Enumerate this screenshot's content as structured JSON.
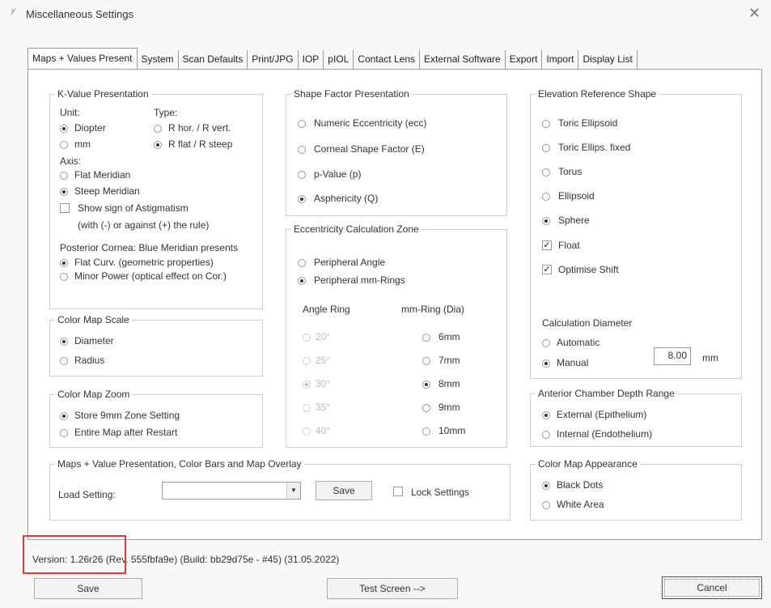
{
  "window": {
    "title": "Miscellaneous Settings",
    "icon_name": "app-icon",
    "close_icon": "close-icon"
  },
  "tabs": [
    "Maps + Values Present",
    "System",
    "Scan Defaults",
    "Print/JPG",
    "IOP",
    "pIOL",
    "Contact Lens",
    "External Software",
    "Export",
    "Import",
    "Display List"
  ],
  "kvalue": {
    "title": "K-Value Presentation",
    "unit_label": "Unit:",
    "type_label": "Type:",
    "unit_options": [
      "Diopter",
      "mm"
    ],
    "unit_selected": "Diopter",
    "type_options": [
      "R hor. / R vert.",
      "R flat / R steep"
    ],
    "type_selected": "R flat / R steep",
    "axis_label": "Axis:",
    "axis_options": [
      "Flat Meridian",
      "Steep Meridian"
    ],
    "axis_selected": "Steep Meridian",
    "astig_label": "Show sign of Astigmatism",
    "astig_checked": false,
    "astig_note": "(with (-) or against (+) the rule)",
    "posterior_label": "Posterior Cornea: Blue Meridian presents",
    "posterior_options": [
      "Flat Curv. (geometric properties)",
      "Minor Power (optical effect on Cor.)"
    ],
    "posterior_selected": "Flat Curv. (geometric properties)"
  },
  "scale": {
    "title": "Color Map Scale",
    "options": [
      "Diameter",
      "Radius"
    ],
    "selected": "Diameter"
  },
  "zoom": {
    "title": "Color Map Zoom",
    "options": [
      "Store 9mm Zone Setting",
      "Entire Map after Restart"
    ],
    "selected": "Store 9mm Zone Setting"
  },
  "shape": {
    "title": "Shape Factor Presentation",
    "options": [
      "Numeric Eccentricity (ecc)",
      "Corneal Shape Factor (E)",
      "p-Value (p)",
      "Asphericity (Q)"
    ],
    "selected": "Asphericity (Q)"
  },
  "ecc": {
    "title": "Eccentricity Calculation Zone",
    "options": [
      "Peripheral Angle",
      "Peripheral mm-Rings"
    ],
    "selected": "Peripheral mm-Rings",
    "angle_header": "Angle Ring",
    "mm_header": "mm-Ring (Dia)",
    "angles": [
      "20°",
      "25°",
      "30°",
      "35°",
      "40°"
    ],
    "angle_selected": "30°",
    "rings": [
      "6mm",
      "7mm",
      "8mm",
      "9mm",
      "10mm"
    ],
    "ring_selected": "8mm"
  },
  "elev": {
    "title": "Elevation Reference Shape",
    "options": [
      "Toric Ellipsoid",
      "Toric Ellips. fixed",
      "Torus",
      "Ellipsoid",
      "Sphere"
    ],
    "selected": "Sphere",
    "float_label": "Float",
    "float_checked": true,
    "shift_label": "Optimise Shift",
    "shift_checked": true,
    "calc_label": "Calculation Diameter",
    "calc_options": [
      "Automatic",
      "Manual"
    ],
    "calc_selected": "Manual",
    "manual_value": "8.00",
    "unit": "mm"
  },
  "acd": {
    "title": "Anterior Chamber Depth Range",
    "options": [
      "External (Epithelium)",
      "Internal (Endothelium)"
    ],
    "selected": "External (Epithelium)"
  },
  "appearance": {
    "title": "Color Map Appearance",
    "options": [
      "Black Dots",
      "White Area"
    ],
    "selected": "Black Dots"
  },
  "mapsval": {
    "title": "Maps + Value Presentation, Color Bars and Map Overlay",
    "load_label": "Load Setting:",
    "combo_value": "",
    "save_label": "Save",
    "lock_label": "Lock Settings",
    "lock_checked": false
  },
  "footer": {
    "version": "Version: 1.26r26 (Rev. 555fbfa9e) (Build: bb29d75e - #45) (31.05.2022)",
    "save": "Save",
    "test": "Test Screen -->",
    "cancel": "Cancel",
    "highlight_color": "#e03b3b"
  }
}
